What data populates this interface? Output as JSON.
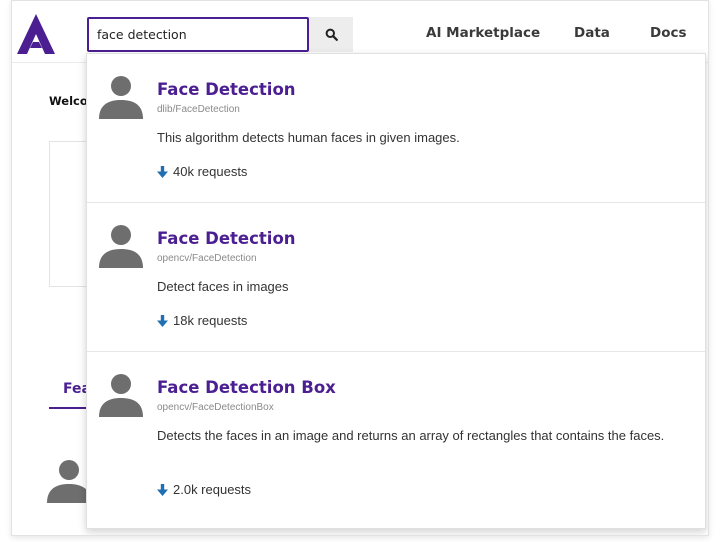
{
  "search": {
    "value": "face detection",
    "placeholder": ""
  },
  "nav": {
    "ai_marketplace": "AI Marketplace",
    "data": "Data",
    "docs": "Docs"
  },
  "background": {
    "welcome_text": "Welco",
    "tab_text": "Fea"
  },
  "results": [
    {
      "title": "Face Detection",
      "path": "dlib/FaceDetection",
      "description": "This algorithm detects human faces in given images.",
      "requests": "40k requests"
    },
    {
      "title": "Face Detection",
      "path": "opencv/FaceDetection",
      "description": "Detect faces in images",
      "requests": "18k requests"
    },
    {
      "title": "Face Detection Box",
      "path": "opencv/FaceDetectionBox",
      "description": "Detects the faces in an image and returns an array of rectangles that contains the faces.",
      "requests": "2.0k requests"
    }
  ],
  "icons": {
    "logo": "algorithmia-logo",
    "search": "magnifier-icon",
    "avatar": "user-avatar-icon",
    "requests": "arrow-down-icon"
  },
  "colors": {
    "brand": "#4b1f91",
    "arrow": "#1f6fb2",
    "avatar": "#6e6e6e"
  }
}
